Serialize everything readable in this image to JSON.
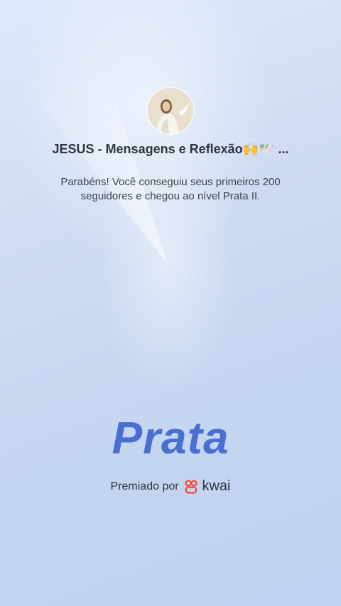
{
  "profile": {
    "name": "JESUS - Mensagens e Reflexão🙌🕊️ ..."
  },
  "message": "Parabéns! Você conseguiu seus primeiros 200 seguidores e chegou ao nível Prata II.",
  "level": {
    "label": "Prata"
  },
  "award": {
    "text": "Premiado por",
    "brand": "kwai",
    "brand_color": "#fe3c1e"
  },
  "colors": {
    "level_text": "#4a6fd1",
    "background": "#c8d8f2"
  }
}
